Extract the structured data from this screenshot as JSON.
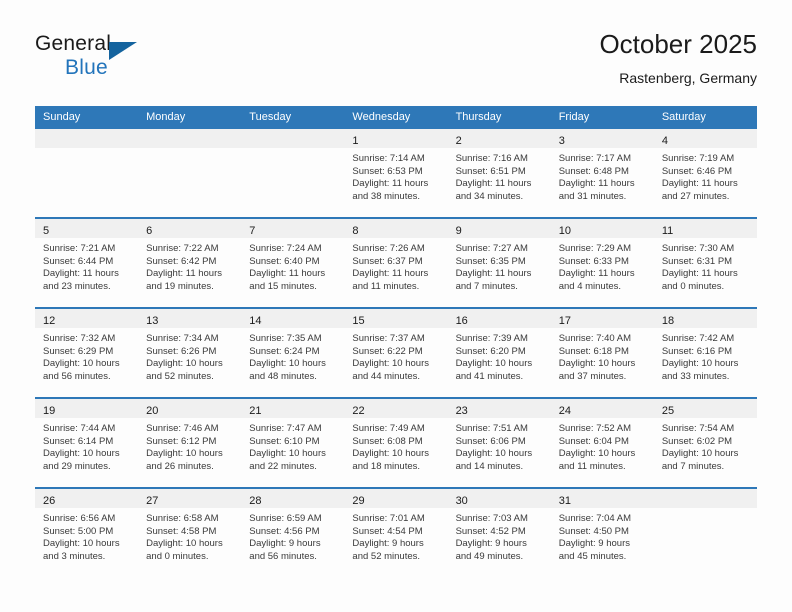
{
  "brand": {
    "name_top": "General",
    "name_bottom": "Blue",
    "triangle_icon": "triangle-logo-icon",
    "color_top": "#1b1b1b",
    "color_bottom": "#2274bb"
  },
  "header": {
    "title": "October 2025",
    "subtitle": "Rastenberg, Germany"
  },
  "colors": {
    "header_blue": "#2e78b8",
    "day_band_grey": "#f0f0f0",
    "page_background": "#fdfdfd",
    "text": "#1b1b1b"
  },
  "weekdays": [
    "Sunday",
    "Monday",
    "Tuesday",
    "Wednesday",
    "Thursday",
    "Friday",
    "Saturday"
  ],
  "labels": {
    "sunrise_prefix": "Sunrise:",
    "sunset_prefix": "Sunset:",
    "daylight_prefix": "Daylight:"
  },
  "weeks": [
    [
      {
        "empty": true
      },
      {
        "empty": true
      },
      {
        "empty": true
      },
      {
        "empty": false,
        "day": "1",
        "sunrise": "Sunrise: 7:14 AM",
        "sunset": "Sunset: 6:53 PM",
        "daylight_line1": "Daylight: 11 hours",
        "daylight_line2": "and 38 minutes."
      },
      {
        "empty": false,
        "day": "2",
        "sunrise": "Sunrise: 7:16 AM",
        "sunset": "Sunset: 6:51 PM",
        "daylight_line1": "Daylight: 11 hours",
        "daylight_line2": "and 34 minutes."
      },
      {
        "empty": false,
        "day": "3",
        "sunrise": "Sunrise: 7:17 AM",
        "sunset": "Sunset: 6:48 PM",
        "daylight_line1": "Daylight: 11 hours",
        "daylight_line2": "and 31 minutes."
      },
      {
        "empty": false,
        "day": "4",
        "sunrise": "Sunrise: 7:19 AM",
        "sunset": "Sunset: 6:46 PM",
        "daylight_line1": "Daylight: 11 hours",
        "daylight_line2": "and 27 minutes."
      }
    ],
    [
      {
        "empty": false,
        "day": "5",
        "sunrise": "Sunrise: 7:21 AM",
        "sunset": "Sunset: 6:44 PM",
        "daylight_line1": "Daylight: 11 hours",
        "daylight_line2": "and 23 minutes."
      },
      {
        "empty": false,
        "day": "6",
        "sunrise": "Sunrise: 7:22 AM",
        "sunset": "Sunset: 6:42 PM",
        "daylight_line1": "Daylight: 11 hours",
        "daylight_line2": "and 19 minutes."
      },
      {
        "empty": false,
        "day": "7",
        "sunrise": "Sunrise: 7:24 AM",
        "sunset": "Sunset: 6:40 PM",
        "daylight_line1": "Daylight: 11 hours",
        "daylight_line2": "and 15 minutes."
      },
      {
        "empty": false,
        "day": "8",
        "sunrise": "Sunrise: 7:26 AM",
        "sunset": "Sunset: 6:37 PM",
        "daylight_line1": "Daylight: 11 hours",
        "daylight_line2": "and 11 minutes."
      },
      {
        "empty": false,
        "day": "9",
        "sunrise": "Sunrise: 7:27 AM",
        "sunset": "Sunset: 6:35 PM",
        "daylight_line1": "Daylight: 11 hours",
        "daylight_line2": "and 7 minutes."
      },
      {
        "empty": false,
        "day": "10",
        "sunrise": "Sunrise: 7:29 AM",
        "sunset": "Sunset: 6:33 PM",
        "daylight_line1": "Daylight: 11 hours",
        "daylight_line2": "and 4 minutes."
      },
      {
        "empty": false,
        "day": "11",
        "sunrise": "Sunrise: 7:30 AM",
        "sunset": "Sunset: 6:31 PM",
        "daylight_line1": "Daylight: 11 hours",
        "daylight_line2": "and 0 minutes."
      }
    ],
    [
      {
        "empty": false,
        "day": "12",
        "sunrise": "Sunrise: 7:32 AM",
        "sunset": "Sunset: 6:29 PM",
        "daylight_line1": "Daylight: 10 hours",
        "daylight_line2": "and 56 minutes."
      },
      {
        "empty": false,
        "day": "13",
        "sunrise": "Sunrise: 7:34 AM",
        "sunset": "Sunset: 6:26 PM",
        "daylight_line1": "Daylight: 10 hours",
        "daylight_line2": "and 52 minutes."
      },
      {
        "empty": false,
        "day": "14",
        "sunrise": "Sunrise: 7:35 AM",
        "sunset": "Sunset: 6:24 PM",
        "daylight_line1": "Daylight: 10 hours",
        "daylight_line2": "and 48 minutes."
      },
      {
        "empty": false,
        "day": "15",
        "sunrise": "Sunrise: 7:37 AM",
        "sunset": "Sunset: 6:22 PM",
        "daylight_line1": "Daylight: 10 hours",
        "daylight_line2": "and 44 minutes."
      },
      {
        "empty": false,
        "day": "16",
        "sunrise": "Sunrise: 7:39 AM",
        "sunset": "Sunset: 6:20 PM",
        "daylight_line1": "Daylight: 10 hours",
        "daylight_line2": "and 41 minutes."
      },
      {
        "empty": false,
        "day": "17",
        "sunrise": "Sunrise: 7:40 AM",
        "sunset": "Sunset: 6:18 PM",
        "daylight_line1": "Daylight: 10 hours",
        "daylight_line2": "and 37 minutes."
      },
      {
        "empty": false,
        "day": "18",
        "sunrise": "Sunrise: 7:42 AM",
        "sunset": "Sunset: 6:16 PM",
        "daylight_line1": "Daylight: 10 hours",
        "daylight_line2": "and 33 minutes."
      }
    ],
    [
      {
        "empty": false,
        "day": "19",
        "sunrise": "Sunrise: 7:44 AM",
        "sunset": "Sunset: 6:14 PM",
        "daylight_line1": "Daylight: 10 hours",
        "daylight_line2": "and 29 minutes."
      },
      {
        "empty": false,
        "day": "20",
        "sunrise": "Sunrise: 7:46 AM",
        "sunset": "Sunset: 6:12 PM",
        "daylight_line1": "Daylight: 10 hours",
        "daylight_line2": "and 26 minutes."
      },
      {
        "empty": false,
        "day": "21",
        "sunrise": "Sunrise: 7:47 AM",
        "sunset": "Sunset: 6:10 PM",
        "daylight_line1": "Daylight: 10 hours",
        "daylight_line2": "and 22 minutes."
      },
      {
        "empty": false,
        "day": "22",
        "sunrise": "Sunrise: 7:49 AM",
        "sunset": "Sunset: 6:08 PM",
        "daylight_line1": "Daylight: 10 hours",
        "daylight_line2": "and 18 minutes."
      },
      {
        "empty": false,
        "day": "23",
        "sunrise": "Sunrise: 7:51 AM",
        "sunset": "Sunset: 6:06 PM",
        "daylight_line1": "Daylight: 10 hours",
        "daylight_line2": "and 14 minutes."
      },
      {
        "empty": false,
        "day": "24",
        "sunrise": "Sunrise: 7:52 AM",
        "sunset": "Sunset: 6:04 PM",
        "daylight_line1": "Daylight: 10 hours",
        "daylight_line2": "and 11 minutes."
      },
      {
        "empty": false,
        "day": "25",
        "sunrise": "Sunrise: 7:54 AM",
        "sunset": "Sunset: 6:02 PM",
        "daylight_line1": "Daylight: 10 hours",
        "daylight_line2": "and 7 minutes."
      }
    ],
    [
      {
        "empty": false,
        "day": "26",
        "sunrise": "Sunrise: 6:56 AM",
        "sunset": "Sunset: 5:00 PM",
        "daylight_line1": "Daylight: 10 hours",
        "daylight_line2": "and 3 minutes."
      },
      {
        "empty": false,
        "day": "27",
        "sunrise": "Sunrise: 6:58 AM",
        "sunset": "Sunset: 4:58 PM",
        "daylight_line1": "Daylight: 10 hours",
        "daylight_line2": "and 0 minutes."
      },
      {
        "empty": false,
        "day": "28",
        "sunrise": "Sunrise: 6:59 AM",
        "sunset": "Sunset: 4:56 PM",
        "daylight_line1": "Daylight: 9 hours",
        "daylight_line2": "and 56 minutes."
      },
      {
        "empty": false,
        "day": "29",
        "sunrise": "Sunrise: 7:01 AM",
        "sunset": "Sunset: 4:54 PM",
        "daylight_line1": "Daylight: 9 hours",
        "daylight_line2": "and 52 minutes."
      },
      {
        "empty": false,
        "day": "30",
        "sunrise": "Sunrise: 7:03 AM",
        "sunset": "Sunset: 4:52 PM",
        "daylight_line1": "Daylight: 9 hours",
        "daylight_line2": "and 49 minutes."
      },
      {
        "empty": false,
        "day": "31",
        "sunrise": "Sunrise: 7:04 AM",
        "sunset": "Sunset: 4:50 PM",
        "daylight_line1": "Daylight: 9 hours",
        "daylight_line2": "and 45 minutes."
      },
      {
        "empty": true
      }
    ]
  ]
}
